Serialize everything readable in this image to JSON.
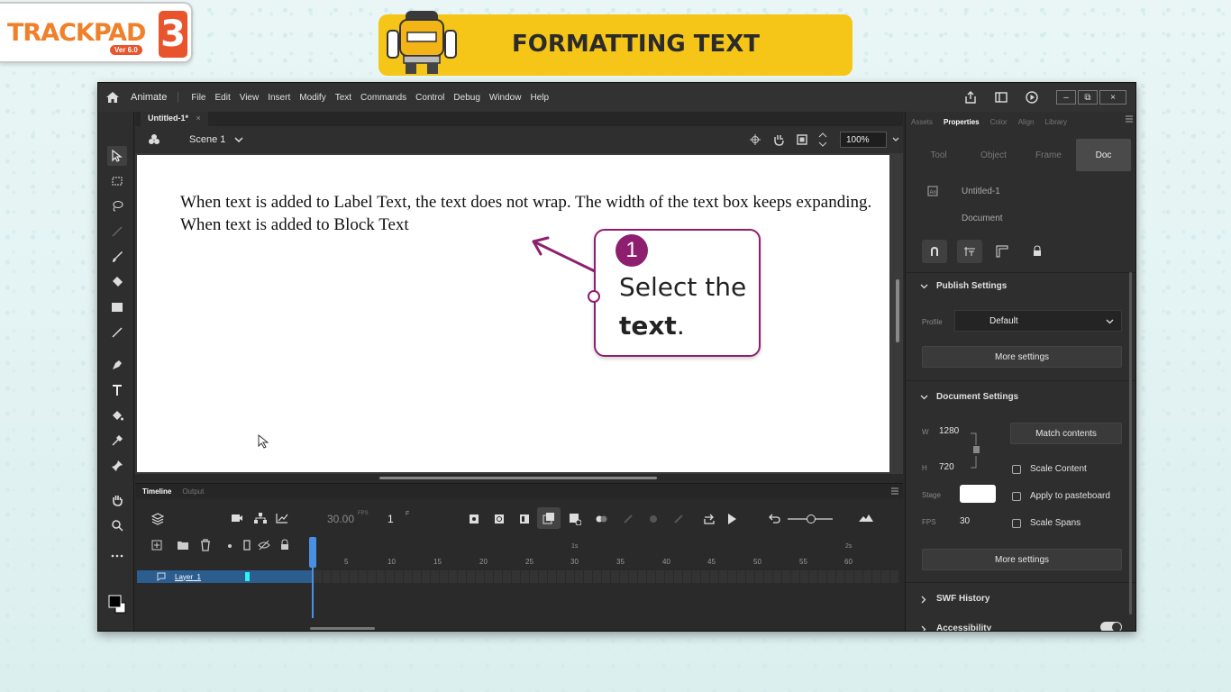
{
  "branding": {
    "logo_text": "TRACKPAD",
    "version": "Ver 6.0",
    "level": "3"
  },
  "banner": {
    "title": "FORMATTING TEXT"
  },
  "app": {
    "name": "Animate",
    "menu": [
      "File",
      "Edit",
      "View",
      "Insert",
      "Modify",
      "Text",
      "Commands",
      "Control",
      "Debug",
      "Window",
      "Help"
    ],
    "window_controls": {
      "minimize": "–",
      "restore": "⧉",
      "close": "×"
    }
  },
  "document": {
    "tab_title": "Untitled-1*",
    "tab_close": "×",
    "scene": "Scene 1",
    "zoom": "100%"
  },
  "stage": {
    "text": "When text is added to Label Text, the text does not wrap. The width of the text box keeps expanding. When text is added to Block Text"
  },
  "callout": {
    "step": "1",
    "line1": "Select the",
    "line2_bold": "text",
    "line2_rest": "."
  },
  "timeline": {
    "tabs": {
      "timeline": "Timeline",
      "output": "Output"
    },
    "fps": "30.00",
    "fps_unit": "FPS",
    "frame": "1",
    "frame_unit": "F",
    "layer_name": "Layer_1",
    "ruler_marks": [
      "5",
      "10",
      "15",
      "20",
      "25",
      "30",
      "35",
      "40",
      "45",
      "50",
      "55",
      "60"
    ],
    "seconds_marks": [
      "1s",
      "2s"
    ]
  },
  "panel": {
    "tabs": [
      "Assets",
      "Properties",
      "Color",
      "Align",
      "Library"
    ],
    "active_tab": "Properties",
    "prop_tabs": [
      "Tool",
      "Object",
      "Frame",
      "Doc"
    ],
    "active_prop_tab": "Doc",
    "doc_name": "Untitled-1",
    "doc_type": "Document",
    "publish": {
      "header": "Publish Settings",
      "profile_label": "Profile",
      "profile_value": "Default",
      "more_settings": "More settings"
    },
    "doc_settings": {
      "header": "Document Settings",
      "w_label": "W",
      "w_value": "1280",
      "h_label": "H",
      "h_value": "720",
      "match_contents": "Match contents",
      "scale_content": "Scale Content",
      "stage_label": "Stage",
      "stage_color": "#ffffff",
      "apply_pasteboard": "Apply to pasteboard",
      "fps_label": "FPS",
      "fps_value": "30",
      "scale_spans": "Scale Spans",
      "more_settings": "More settings"
    },
    "swf_history": "SWF History",
    "accessibility": "Accessibility"
  },
  "colors": {
    "banner": "#f5c518",
    "callout_accent": "#8e1f6e",
    "brand_orange": "#f0802a",
    "selected_layer": "#2c5d8f"
  }
}
